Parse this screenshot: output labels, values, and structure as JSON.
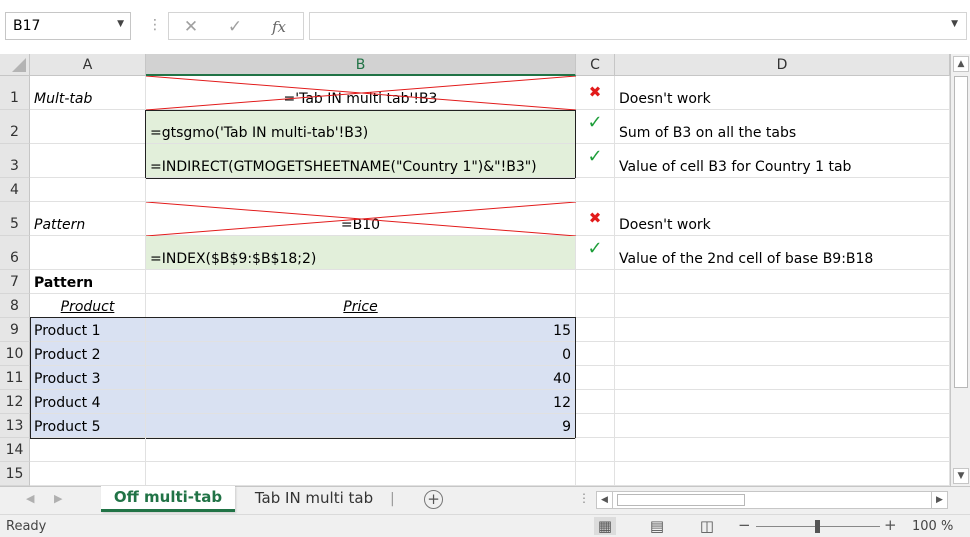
{
  "formula_bar": {
    "name_box": "B17",
    "cancel_icon": "✕",
    "enter_icon": "✓",
    "function_icon": "fx",
    "formula": ""
  },
  "columns": [
    "A",
    "B",
    "C",
    "D"
  ],
  "rows": [
    "1",
    "2",
    "3",
    "4",
    "5",
    "6",
    "7",
    "8",
    "9",
    "10",
    "11",
    "12",
    "13",
    "14",
    "15"
  ],
  "cells": {
    "A1": "Mult-tab",
    "B1": "='Tab IN multi tab'!B3",
    "C1": "✖",
    "D1": "Doesn't work",
    "B2": "=gtsgmo('Tab IN multi-tab'!B3)",
    "C2": "✓",
    "D2": "Sum of B3 on all the tabs",
    "B3": "=INDIRECT(GTMOGETSHEETNAME(\"Country 1\")&\"!B3\")",
    "C3": "✓",
    "D3": "Value of cell B3 for Country 1 tab",
    "A5": "Pattern",
    "B5": "=B10",
    "C5": "✖",
    "D5": "Doesn't work",
    "B6": "=INDEX($B$9:$B$18;2)",
    "C6": "✓",
    "D6": "Value of the 2nd cell of base B9:B18",
    "A7": "Pattern",
    "A8": "Product",
    "B8": "Price"
  },
  "table": [
    {
      "product": "Product 1",
      "price": "15"
    },
    {
      "product": "Product 2",
      "price": "0"
    },
    {
      "product": "Product 3",
      "price": "40"
    },
    {
      "product": "Product 4",
      "price": "12"
    },
    {
      "product": "Product 5",
      "price": "9"
    }
  ],
  "tabs": {
    "active": "Off multi-tab",
    "other": "Tab IN multi tab",
    "add": "+"
  },
  "status": {
    "ready": "Ready",
    "zoom": "100 %"
  },
  "colors": {
    "accent": "#217346",
    "green_fill": "#e2efda",
    "blue_fill": "#d9e1f2",
    "cross": "#e21b1b",
    "check": "#1e9e3a"
  }
}
